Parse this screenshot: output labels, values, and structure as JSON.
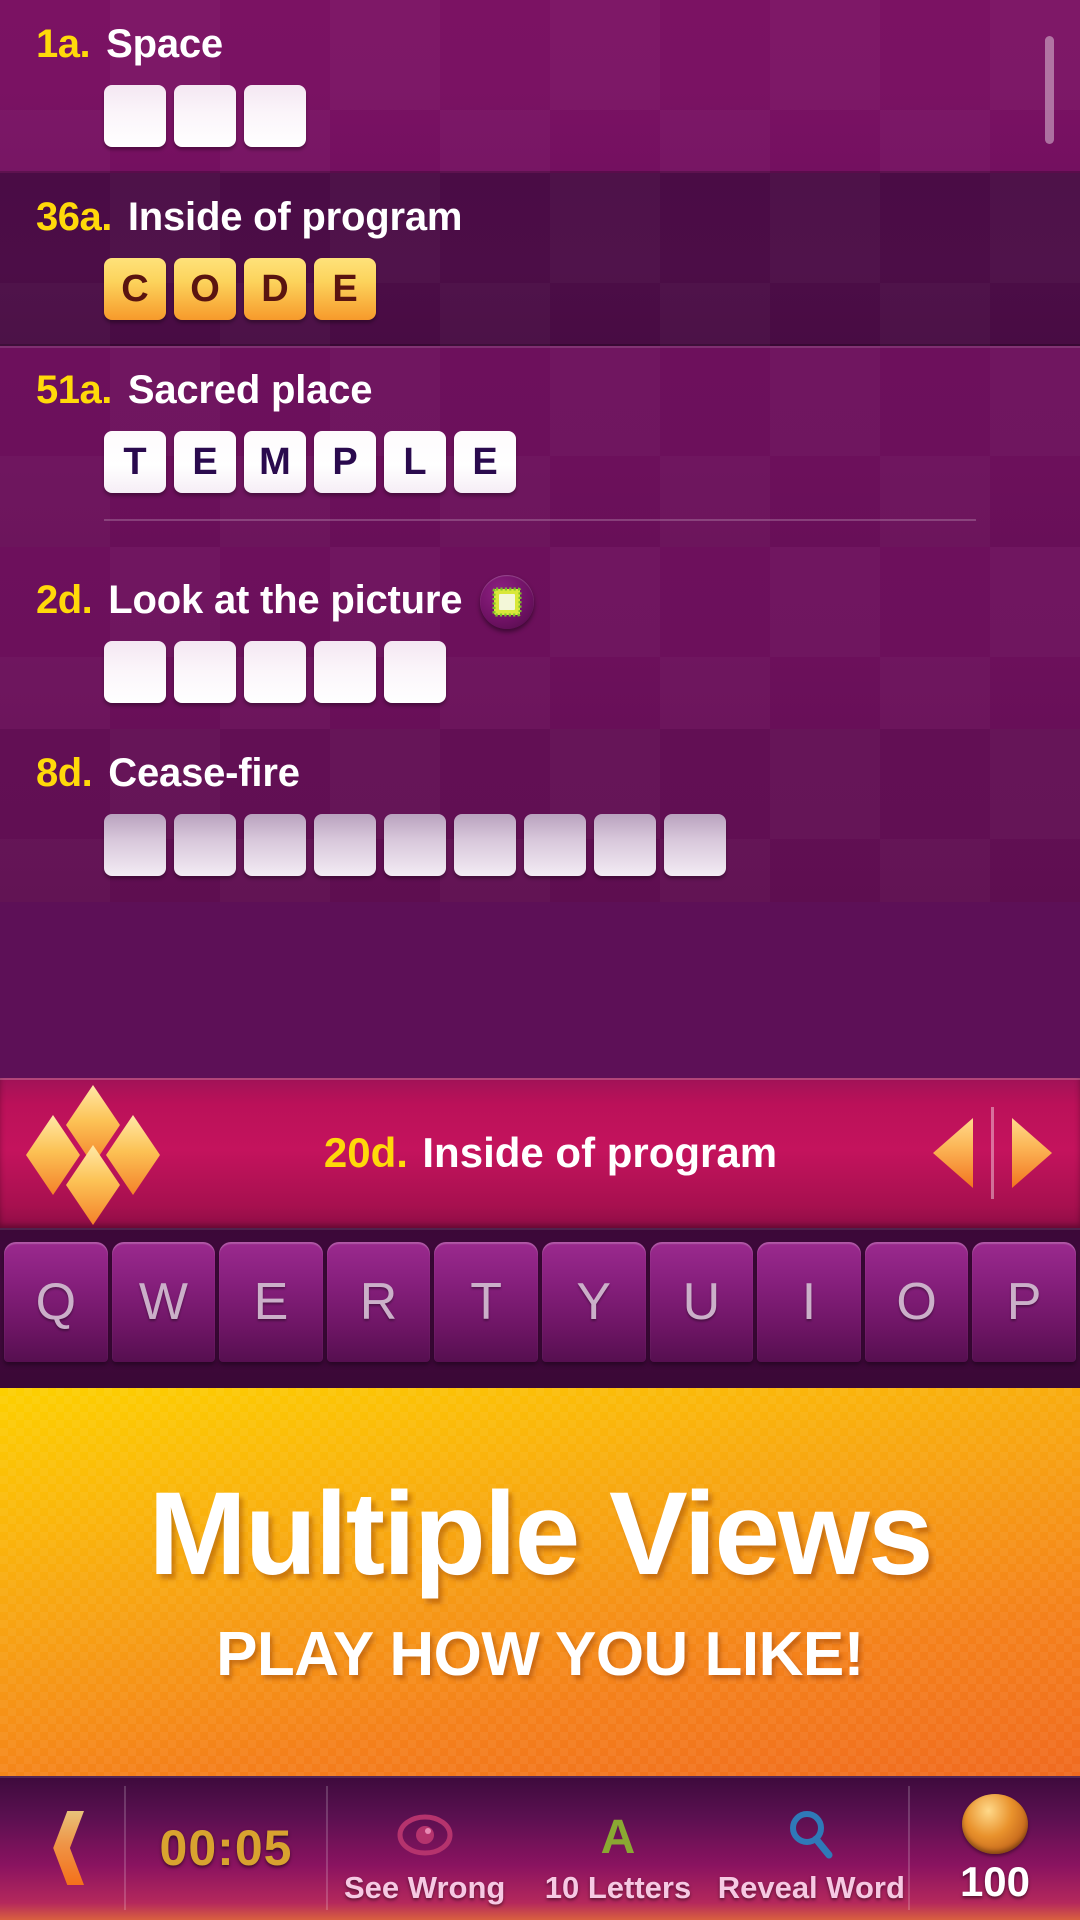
{
  "clue_list": {
    "rows": [
      {
        "number": "1a.",
        "text": "Space",
        "length": 3,
        "letters": [
          "",
          "",
          ""
        ],
        "state": "empty",
        "has_picture_icon": false
      },
      {
        "number": "36a.",
        "text": "Inside of program",
        "length": 4,
        "letters": [
          "C",
          "O",
          "D",
          "E"
        ],
        "state": "gold",
        "has_picture_icon": false
      },
      {
        "number": "51a.",
        "text": "Sacred place",
        "length": 6,
        "letters": [
          "T",
          "E",
          "M",
          "P",
          "L",
          "E"
        ],
        "state": "filled",
        "has_picture_icon": false
      },
      {
        "number": "2d.",
        "text": "Look at the picture",
        "length": 5,
        "letters": [
          "",
          "",
          "",
          "",
          ""
        ],
        "state": "empty",
        "has_picture_icon": true,
        "picture_icon_name": "picture-frame-icon"
      },
      {
        "number": "8d.",
        "text": "Cease-fire",
        "length": 9,
        "letters": [
          "",
          "",
          "",
          "",
          "",
          "",
          "",
          "",
          ""
        ],
        "state": "empty-dim",
        "has_picture_icon": false
      }
    ],
    "scrollbar_name": "clue-list-scrollbar"
  },
  "current_clue": {
    "number": "20d.",
    "text": "Inside of program",
    "diamond_icon_name": "diamond-cluster-icon",
    "prev_label": "◀",
    "next_label": "▶"
  },
  "keyboard": {
    "row1": [
      "Q",
      "W",
      "E",
      "R",
      "T",
      "Y",
      "U",
      "I",
      "O",
      "P"
    ]
  },
  "ad": {
    "title": "Multiple Views",
    "subtitle": "PLAY HOW YOU LIKE!"
  },
  "bottom_bar": {
    "back_icon_name": "back-chevron-icon",
    "timer": "00:05",
    "tools": [
      {
        "label": "See Wrong",
        "icon": "eye-icon",
        "color": "#b5336d"
      },
      {
        "label": "10 Letters",
        "icon": "letter-a-icon",
        "color": "#8aa832"
      },
      {
        "label": "Reveal Word",
        "icon": "magnifier-icon",
        "color": "#2f79b8"
      }
    ],
    "coins": "100",
    "coin_icon_name": "coin-icon"
  },
  "colors": {
    "accent_yellow": "#ffd90a",
    "clue_bar_pink": "#c4135d",
    "tile_gold_top": "#ffe27a",
    "tile_gold_bottom": "#f79a2b",
    "ad_orange": "#f4801b"
  }
}
